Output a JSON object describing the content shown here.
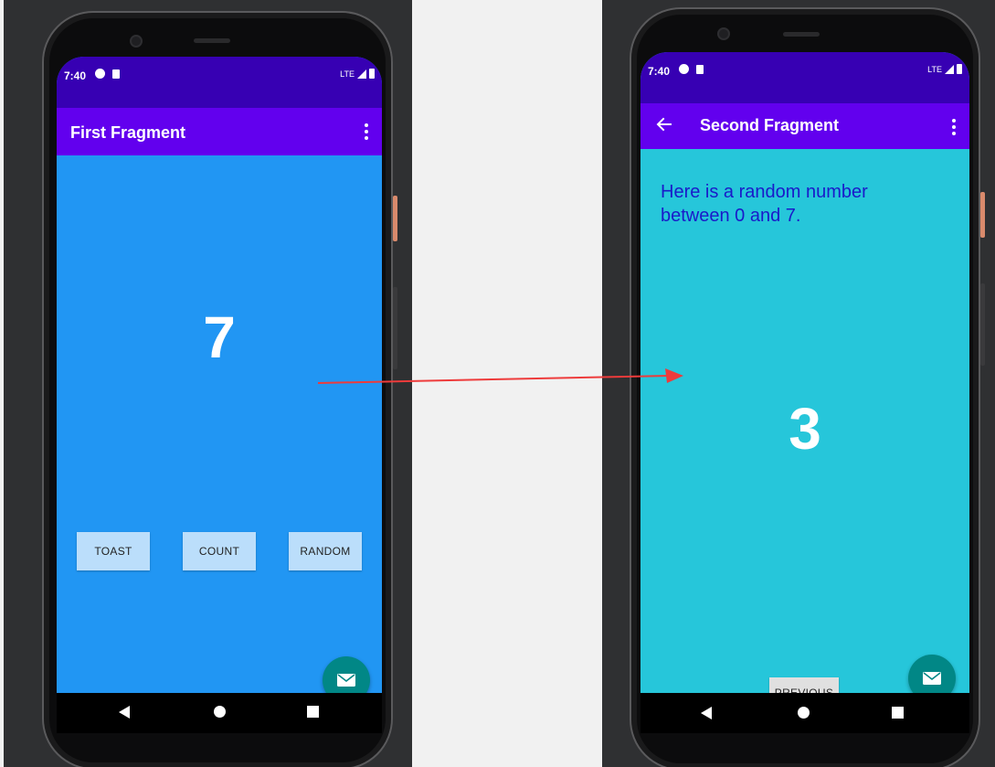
{
  "left_phone": {
    "status_time": "7:40",
    "status_network": "LTE",
    "app_title": "First Fragment",
    "count_value": "7",
    "buttons": {
      "toast": "TOAST",
      "count": "COUNT",
      "random": "RANDOM"
    },
    "fab_icon": "mail-icon",
    "colors": {
      "background": "#2196f3",
      "status_bar": "#3700b3",
      "app_bar": "#6200ee",
      "button": "#bbdefb",
      "fab": "#018786"
    }
  },
  "right_phone": {
    "status_time": "7:40",
    "status_network": "LTE",
    "app_title": "Second Fragment",
    "random_label": "Here is a random number between 0 and 7.",
    "random_value": "3",
    "previous_button": "PREVIOUS",
    "fab_icon": "mail-icon",
    "colors": {
      "background": "#26c6da",
      "status_bar": "#3700b3",
      "app_bar": "#6200ee",
      "label_text": "#1a1ac9",
      "fab": "#018786"
    }
  },
  "annotation": {
    "arrow_color": "#ee3b3b"
  }
}
